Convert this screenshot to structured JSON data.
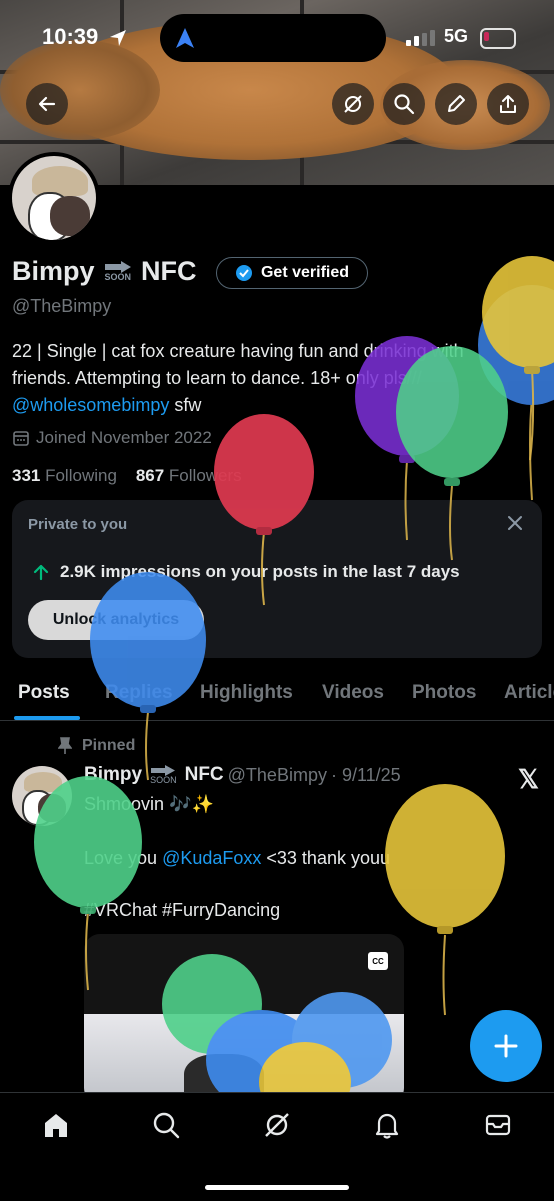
{
  "status_bar": {
    "time": "10:39",
    "network": "5G"
  },
  "header_buttons": [
    "back-arrow-icon",
    "grok-icon",
    "search-icon",
    "edit-icon",
    "share-icon"
  ],
  "profile": {
    "name_part1": "Bimpy",
    "soon_label": "SOON",
    "name_part2": "NFC",
    "verify_label": "Get verified",
    "handle": "@TheBimpy",
    "bio_line1": "22 | Single | cat fox creature having fun and drinking with",
    "bio_line2": "friends. Attempting to learn to dance. 18+ only pls///",
    "bio_link": "@wholesomebimpy",
    "bio_suffix": " sfw",
    "joined": "Joined November 2022",
    "following_count": "331",
    "following_label": " Following",
    "followers_count": "867",
    "followers_label": " Followers"
  },
  "analytics_card": {
    "private_label": "Private to you",
    "impressions_text": "2.9K impressions on your posts in the last 7 days",
    "unlock_label": "Unlock analytics"
  },
  "tabs": [
    {
      "label": "Posts",
      "active": true
    },
    {
      "label": "Replies"
    },
    {
      "label": "Highlights"
    },
    {
      "label": "Videos"
    },
    {
      "label": "Photos"
    },
    {
      "label": "Articles"
    }
  ],
  "pinned_post": {
    "pinned_label": "Pinned",
    "author_part1": "Bimpy",
    "soon_label": "SOON",
    "author_part2": "NFC",
    "handle": "@TheBimpy",
    "date": "· 9/11/25",
    "line1": "Shmoovin 🎶✨",
    "line2_prefix": "Love you ",
    "line2_mention": "@KudaFoxx",
    "line2_suffix": " <33 thank youu",
    "hashtags": "#VRChat #FurryDancing",
    "cc_label": "CC"
  },
  "fab_label": "+",
  "bottom_nav": [
    "home-icon",
    "search-icon",
    "grok-icon",
    "notifications-icon",
    "messages-icon"
  ],
  "colors": {
    "accent": "#1d9bf0",
    "background": "#000000",
    "muted": "#71767b",
    "card": "#16181c"
  }
}
